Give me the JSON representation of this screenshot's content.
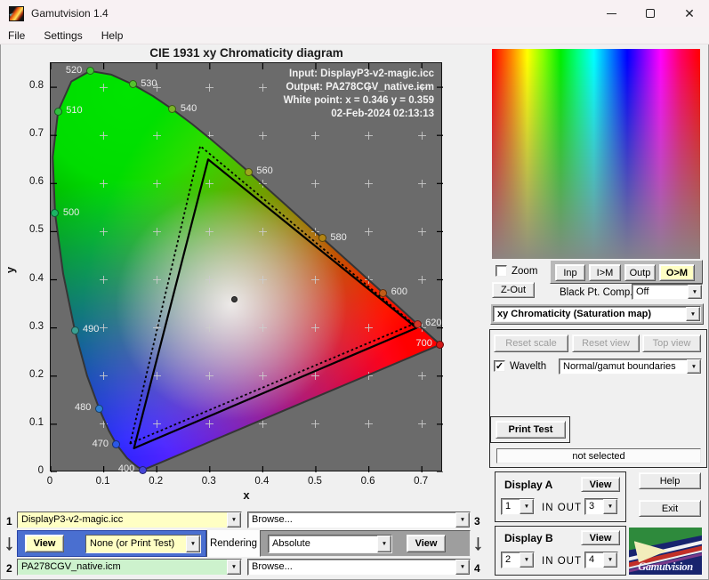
{
  "window": {
    "title": "Gamutvision 1.4"
  },
  "menu": {
    "items": [
      "File",
      "Settings",
      "Help"
    ]
  },
  "chart_data": {
    "type": "chromaticity-diagram",
    "title": "CIE 1931 xy Chromaticity diagram",
    "xlabel": "x",
    "ylabel": "y",
    "xlim": [
      0,
      0.74
    ],
    "ylim": [
      0,
      0.85
    ],
    "x_ticks": [
      "0",
      "0.1",
      "0.2",
      "0.3",
      "0.4",
      "0.5",
      "0.6",
      "0.7"
    ],
    "y_ticks": [
      "0",
      "0.1",
      "0.2",
      "0.3",
      "0.4",
      "0.5",
      "0.6",
      "0.7",
      "0.8"
    ],
    "annotations": [
      "Input:  DisplayP3-v2-magic.icc",
      "Output: PA278CGV_native.icm",
      "White point:  x = 0.346  y = 0.359",
      "02-Feb-2024 02:13:13"
    ],
    "white_point": {
      "x": 0.346,
      "y": 0.359
    },
    "spectral_locus": [
      [
        0.1741,
        0.005
      ],
      [
        0.1644,
        0.0109
      ],
      [
        0.1566,
        0.0177
      ],
      [
        0.144,
        0.0297
      ],
      [
        0.1241,
        0.0578
      ],
      [
        0.1096,
        0.0868
      ],
      [
        0.0913,
        0.1327
      ],
      [
        0.0687,
        0.2007
      ],
      [
        0.0454,
        0.295
      ],
      [
        0.0235,
        0.4127
      ],
      [
        0.0082,
        0.5384
      ],
      [
        0.0039,
        0.6548
      ],
      [
        0.0139,
        0.7502
      ],
      [
        0.0389,
        0.812
      ],
      [
        0.0743,
        0.8338
      ],
      [
        0.1142,
        0.8262
      ],
      [
        0.1547,
        0.8059
      ],
      [
        0.1929,
        0.7816
      ],
      [
        0.2296,
        0.7543
      ],
      [
        0.2658,
        0.7243
      ],
      [
        0.3016,
        0.6923
      ],
      [
        0.3373,
        0.6589
      ],
      [
        0.3731,
        0.6245
      ],
      [
        0.4087,
        0.5896
      ],
      [
        0.4441,
        0.5547
      ],
      [
        0.4788,
        0.5202
      ],
      [
        0.5125,
        0.4866
      ],
      [
        0.5448,
        0.4544
      ],
      [
        0.5752,
        0.4242
      ],
      [
        0.6029,
        0.3965
      ],
      [
        0.627,
        0.3725
      ],
      [
        0.6482,
        0.3514
      ],
      [
        0.6658,
        0.334
      ],
      [
        0.6915,
        0.3083
      ],
      [
        0.7079,
        0.292
      ],
      [
        0.719,
        0.2809
      ],
      [
        0.726,
        0.274
      ],
      [
        0.7347,
        0.2653
      ]
    ],
    "wavelength_markers": [
      {
        "label": "400",
        "x": 0.1733,
        "y": 0.0048,
        "side": "left",
        "color": "#4545d8"
      },
      {
        "label": "470",
        "x": 0.1241,
        "y": 0.0578,
        "side": "left",
        "color": "#2c58e6"
      },
      {
        "label": "480",
        "x": 0.0913,
        "y": 0.1327,
        "side": "left",
        "color": "#2e7fd2"
      },
      {
        "label": "490",
        "x": 0.0454,
        "y": 0.295,
        "side": "right",
        "color": "#3aa093"
      },
      {
        "label": "500",
        "x": 0.0082,
        "y": 0.5384,
        "side": "right",
        "color": "#1cb565"
      },
      {
        "label": "510",
        "x": 0.0139,
        "y": 0.7502,
        "side": "right",
        "color": "#2fc03e"
      },
      {
        "label": "520",
        "x": 0.0743,
        "y": 0.8338,
        "side": "left",
        "color": "#3ecb31"
      },
      {
        "label": "530",
        "x": 0.1547,
        "y": 0.8059,
        "side": "right",
        "color": "#55c22e"
      },
      {
        "label": "540",
        "x": 0.2296,
        "y": 0.7543,
        "side": "right",
        "color": "#78b229"
      },
      {
        "label": "560",
        "x": 0.3731,
        "y": 0.6245,
        "side": "right",
        "color": "#9da81e"
      },
      {
        "label": "580",
        "x": 0.5125,
        "y": 0.4866,
        "side": "right",
        "color": "#b28413"
      },
      {
        "label": "600",
        "x": 0.627,
        "y": 0.3725,
        "side": "right",
        "color": "#c05c18"
      },
      {
        "label": "620",
        "x": 0.6915,
        "y": 0.3083,
        "side": "right",
        "color": "#d43527"
      },
      {
        "label": "700",
        "x": 0.7347,
        "y": 0.2653,
        "side": "left",
        "color": "#d21717"
      }
    ],
    "gamut_triangles": [
      {
        "name": "input-gamut",
        "style": "dashed",
        "points": [
          [
            0.15,
            0.06
          ],
          [
            0.282,
            0.678
          ],
          [
            0.684,
            0.308
          ]
        ]
      },
      {
        "name": "output-gamut",
        "style": "solid",
        "points": [
          [
            0.157,
            0.05
          ],
          [
            0.297,
            0.65
          ],
          [
            0.69,
            0.3
          ]
        ]
      }
    ]
  },
  "right_panel": {
    "zoom_label": "Zoom",
    "io_buttons": [
      {
        "label": "Inp",
        "active": false
      },
      {
        "label": "I>M",
        "active": false
      },
      {
        "label": "Outp",
        "active": false
      },
      {
        "label": "O>M",
        "active": true
      }
    ],
    "z_out": "Z-Out",
    "black_pt_label": "Black Pt. Comp.",
    "black_pt_value": "Off",
    "mode_value": "xy Chromaticity (Saturation map)",
    "reset_scale": "Reset scale",
    "reset_view": "Reset view",
    "top_view": "Top view",
    "wavelth_label": "Wavelth",
    "boundaries_value": "Normal/gamut boundaries",
    "print_test": "Print Test",
    "status": "not selected",
    "display_a": {
      "title": "Display A",
      "view": "View",
      "in_value": "1",
      "inout": "IN OUT",
      "out_value": "3"
    },
    "display_b": {
      "title": "Display B",
      "view": "View",
      "in_value": "2",
      "inout": "IN OUT",
      "out_value": "4"
    },
    "help": "Help",
    "exit": "Exit",
    "logo_text": "Gamutvision"
  },
  "bottom_panel": {
    "slot1": {
      "num": "1",
      "file": "DisplayP3-v2-magic.icc"
    },
    "slot2": {
      "num": "2",
      "file": "PA278CGV_native.icm"
    },
    "slot3": {
      "num": "3",
      "browse": "Browse..."
    },
    "slot4": {
      "num": "4",
      "browse": "Browse..."
    },
    "view_left": "View",
    "test_select": "None (or Print Test)",
    "rendering_label": "Rendering",
    "rendering_value": "Absolute",
    "view_right": "View"
  },
  "colors": {
    "slot1_bg": "#ffffc4",
    "slot2_bg": "#cdf2cd",
    "active_button": "#ffffc4",
    "blue_panel": "#4a6fd0"
  }
}
